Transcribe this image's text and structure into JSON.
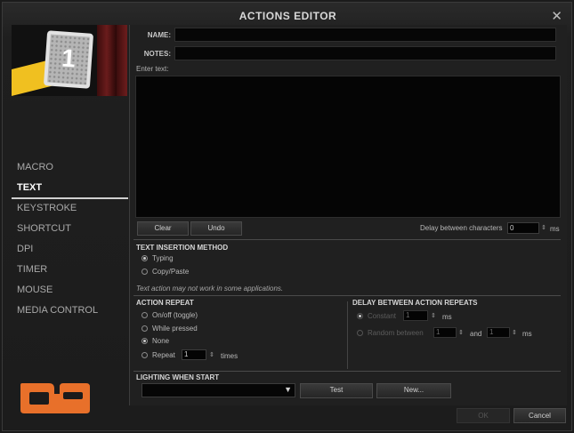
{
  "window": {
    "title": "ACTIONS EDITOR",
    "close_glyph": "✕",
    "close_icon": "close-icon"
  },
  "thumbnail": {
    "key_number": "1"
  },
  "sidebar": {
    "items": [
      {
        "label": "MACRO",
        "active": false
      },
      {
        "label": "TEXT",
        "active": true
      },
      {
        "label": "KEYSTROKE",
        "active": false
      },
      {
        "label": "SHORTCUT",
        "active": false
      },
      {
        "label": "DPI",
        "active": false
      },
      {
        "label": "TIMER",
        "active": false
      },
      {
        "label": "MOUSE",
        "active": false
      },
      {
        "label": "MEDIA CONTROL",
        "active": false
      }
    ]
  },
  "logo": {
    "color": "#e8702a"
  },
  "form": {
    "name_label": "NAME:",
    "name_value": "",
    "notes_label": "NOTES:",
    "notes_value": "",
    "enter_text_label": "Enter text:",
    "text_value": "",
    "clear_label": "Clear",
    "undo_label": "Undo",
    "delay_label": "Delay between characters",
    "delay_value": "0",
    "delay_unit": "ms"
  },
  "insertion": {
    "title": "TEXT INSERTION METHOD",
    "options": [
      {
        "label": "Typing",
        "selected": true
      },
      {
        "label": "Copy/Paste",
        "selected": false
      }
    ],
    "note": "Text action may not work in some applications."
  },
  "repeat": {
    "title": "ACTION REPEAT",
    "options": [
      {
        "label": "On/off (toggle)",
        "selected": false
      },
      {
        "label": "While pressed",
        "selected": false
      },
      {
        "label": "None",
        "selected": true
      },
      {
        "label": "Repeat",
        "selected": false
      }
    ],
    "repeat_value": "1",
    "repeat_unit": "times"
  },
  "delay_repeats": {
    "title": "DELAY BETWEEN ACTION REPEATS",
    "constant_label": "Constant",
    "constant_value": "1",
    "constant_unit": "ms",
    "random_label": "Random between",
    "random_min": "1",
    "and_label": "and",
    "random_max": "1",
    "random_unit": "ms"
  },
  "lighting": {
    "title": "LIGHTING WHEN START",
    "selected": "",
    "arrow": "▼",
    "test_label": "Test",
    "new_label": "New..."
  },
  "footer": {
    "ok_label": "OK",
    "cancel_label": "Cancel"
  },
  "spin_glyph": "⇕"
}
